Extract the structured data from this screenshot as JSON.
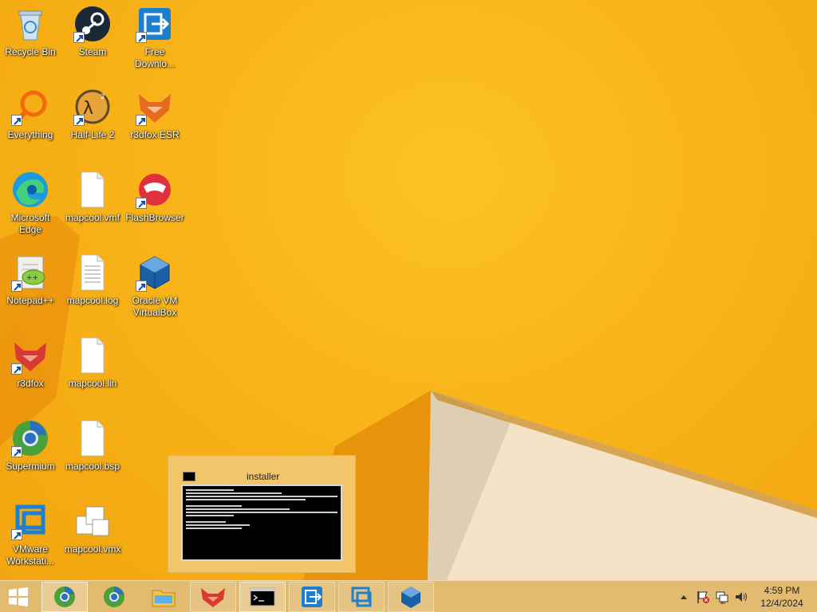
{
  "desktop": {
    "icons": [
      {
        "name": "recycle-bin",
        "label": "Recycle Bin",
        "icon": "recycle-bin-icon"
      },
      {
        "name": "steam",
        "label": "Steam",
        "icon": "steam-icon"
      },
      {
        "name": "free-download",
        "label": "Free Downlo...",
        "icon": "free-download-manager-icon"
      },
      {
        "name": "everything",
        "label": "Everything",
        "icon": "everything-search-icon"
      },
      {
        "name": "half-life-2",
        "label": "Half-Life 2",
        "icon": "half-life-2-icon"
      },
      {
        "name": "r3dfox-esr",
        "label": "r3dfox ESR",
        "icon": "r3dfox-esr-icon"
      },
      {
        "name": "microsoft-edge",
        "label": "Microsoft Edge",
        "icon": "edge-icon"
      },
      {
        "name": "mapcool-vmf",
        "label": "mapcool.vmf",
        "icon": "file-icon"
      },
      {
        "name": "flashbrowser",
        "label": "FlashBrowser",
        "icon": "flashbrowser-icon"
      },
      {
        "name": "notepad-plus-plus",
        "label": "Notepad++",
        "icon": "notepad-plus-plus-icon"
      },
      {
        "name": "mapcool-log",
        "label": "mapcool.log",
        "icon": "text-file-icon"
      },
      {
        "name": "oracle-virtualbox",
        "label": "Oracle VM VirtualBox",
        "icon": "virtualbox-icon"
      },
      {
        "name": "r3dfox",
        "label": "r3dfox",
        "icon": "r3dfox-icon"
      },
      {
        "name": "mapcool-lin",
        "label": "mapcool.lin",
        "icon": "file-icon"
      },
      {
        "name": "supermium",
        "label": "Supermium",
        "icon": "supermium-icon"
      },
      {
        "name": "mapcool-bsp",
        "label": "mapcool.bsp",
        "icon": "file-icon"
      },
      {
        "name": "vmware-workstation",
        "label": "VMware Workstati...",
        "icon": "vmware-icon"
      },
      {
        "name": "mapcool-vmx",
        "label": "mapcool.vmx",
        "icon": "vmx-file-icon"
      }
    ]
  },
  "preview": {
    "title": "installer"
  },
  "taskbar": {
    "start": "windows-start-icon",
    "buttons": [
      {
        "name": "supermium",
        "icon": "supermium-icon"
      },
      {
        "name": "supermium-2",
        "icon": "supermium-icon"
      },
      {
        "name": "file-explorer",
        "icon": "folder-icon"
      },
      {
        "name": "r3dfox",
        "icon": "r3dfox-icon"
      },
      {
        "name": "installer-cmd",
        "icon": "cmd-icon"
      },
      {
        "name": "free-download-manager",
        "icon": "free-download-manager-icon"
      },
      {
        "name": "vmware",
        "icon": "vmware-icon"
      },
      {
        "name": "virtualbox",
        "icon": "virtualbox-icon"
      }
    ],
    "tray": {
      "time": "4:59 PM",
      "date": "12/4/2024"
    }
  }
}
